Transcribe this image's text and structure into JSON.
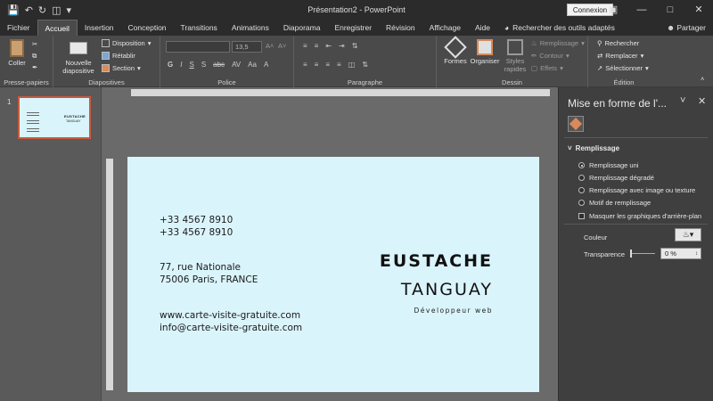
{
  "titlebar": {
    "document_title": "Présentation2 - PowerPoint",
    "connexion_label": "Connexion"
  },
  "tabs": [
    {
      "label": "Fichier"
    },
    {
      "label": "Accueil"
    },
    {
      "label": "Insertion"
    },
    {
      "label": "Conception"
    },
    {
      "label": "Transitions"
    },
    {
      "label": "Animations"
    },
    {
      "label": "Diaporama"
    },
    {
      "label": "Enregistrer"
    },
    {
      "label": "Révision"
    },
    {
      "label": "Affichage"
    },
    {
      "label": "Aide"
    }
  ],
  "search_tools": "Rechercher des outils adaptés",
  "share_label": "Partager",
  "ribbon": {
    "clipboard": {
      "paste": "Coller",
      "group": "Presse-papiers"
    },
    "slides": {
      "new_slide_line1": "Nouvelle",
      "new_slide_line2": "diapositive",
      "layout": "Disposition",
      "reset": "Rétablir",
      "section": "Section",
      "group": "Diapositives"
    },
    "font": {
      "size": "13,5",
      "group": "Police"
    },
    "paragraph": {
      "group": "Paragraphe"
    },
    "drawing": {
      "shapes": "Formes",
      "arrange": "Organiser",
      "styles_line1": "Styles",
      "styles_line2": "rapides",
      "fill": "Remplissage",
      "outline": "Contour",
      "effects": "Effets",
      "group": "Dessin"
    },
    "editing": {
      "find": "Rechercher",
      "replace": "Remplacer",
      "select": "Sélectionner",
      "group": "Édition"
    }
  },
  "thumbnails": {
    "slide_number": "1"
  },
  "slide": {
    "phone1": "+33 4567 8910",
    "phone2": "+33 4567 8910",
    "address1": "77, rue Nationale",
    "address2": "75006 Paris, FRANCE",
    "website": "www.carte-visite-gratuite.com",
    "email": "info@carte-visite-gratuite.com",
    "first_name": "EUSTACHE",
    "last_name": "TANGUAY",
    "job_title": "Développeur web",
    "background_color": "#daf4fb"
  },
  "format_pane": {
    "title": "Mise en forme de l'...",
    "section": "Remplissage",
    "options": [
      {
        "label": "Remplissage uni",
        "selected": true
      },
      {
        "label": "Remplissage dégradé",
        "selected": false
      },
      {
        "label": "Remplissage avec image ou texture",
        "selected": false
      },
      {
        "label": "Motif de remplissage",
        "selected": false
      }
    ],
    "hide_graphics": "Masquer les graphiques d'arrière-plan",
    "color_label": "Couleur",
    "transparency_label": "Transparence",
    "transparency_value": "0 %"
  },
  "colors": {
    "accent": "#c75a3f",
    "dark": "#2b2b2b"
  }
}
